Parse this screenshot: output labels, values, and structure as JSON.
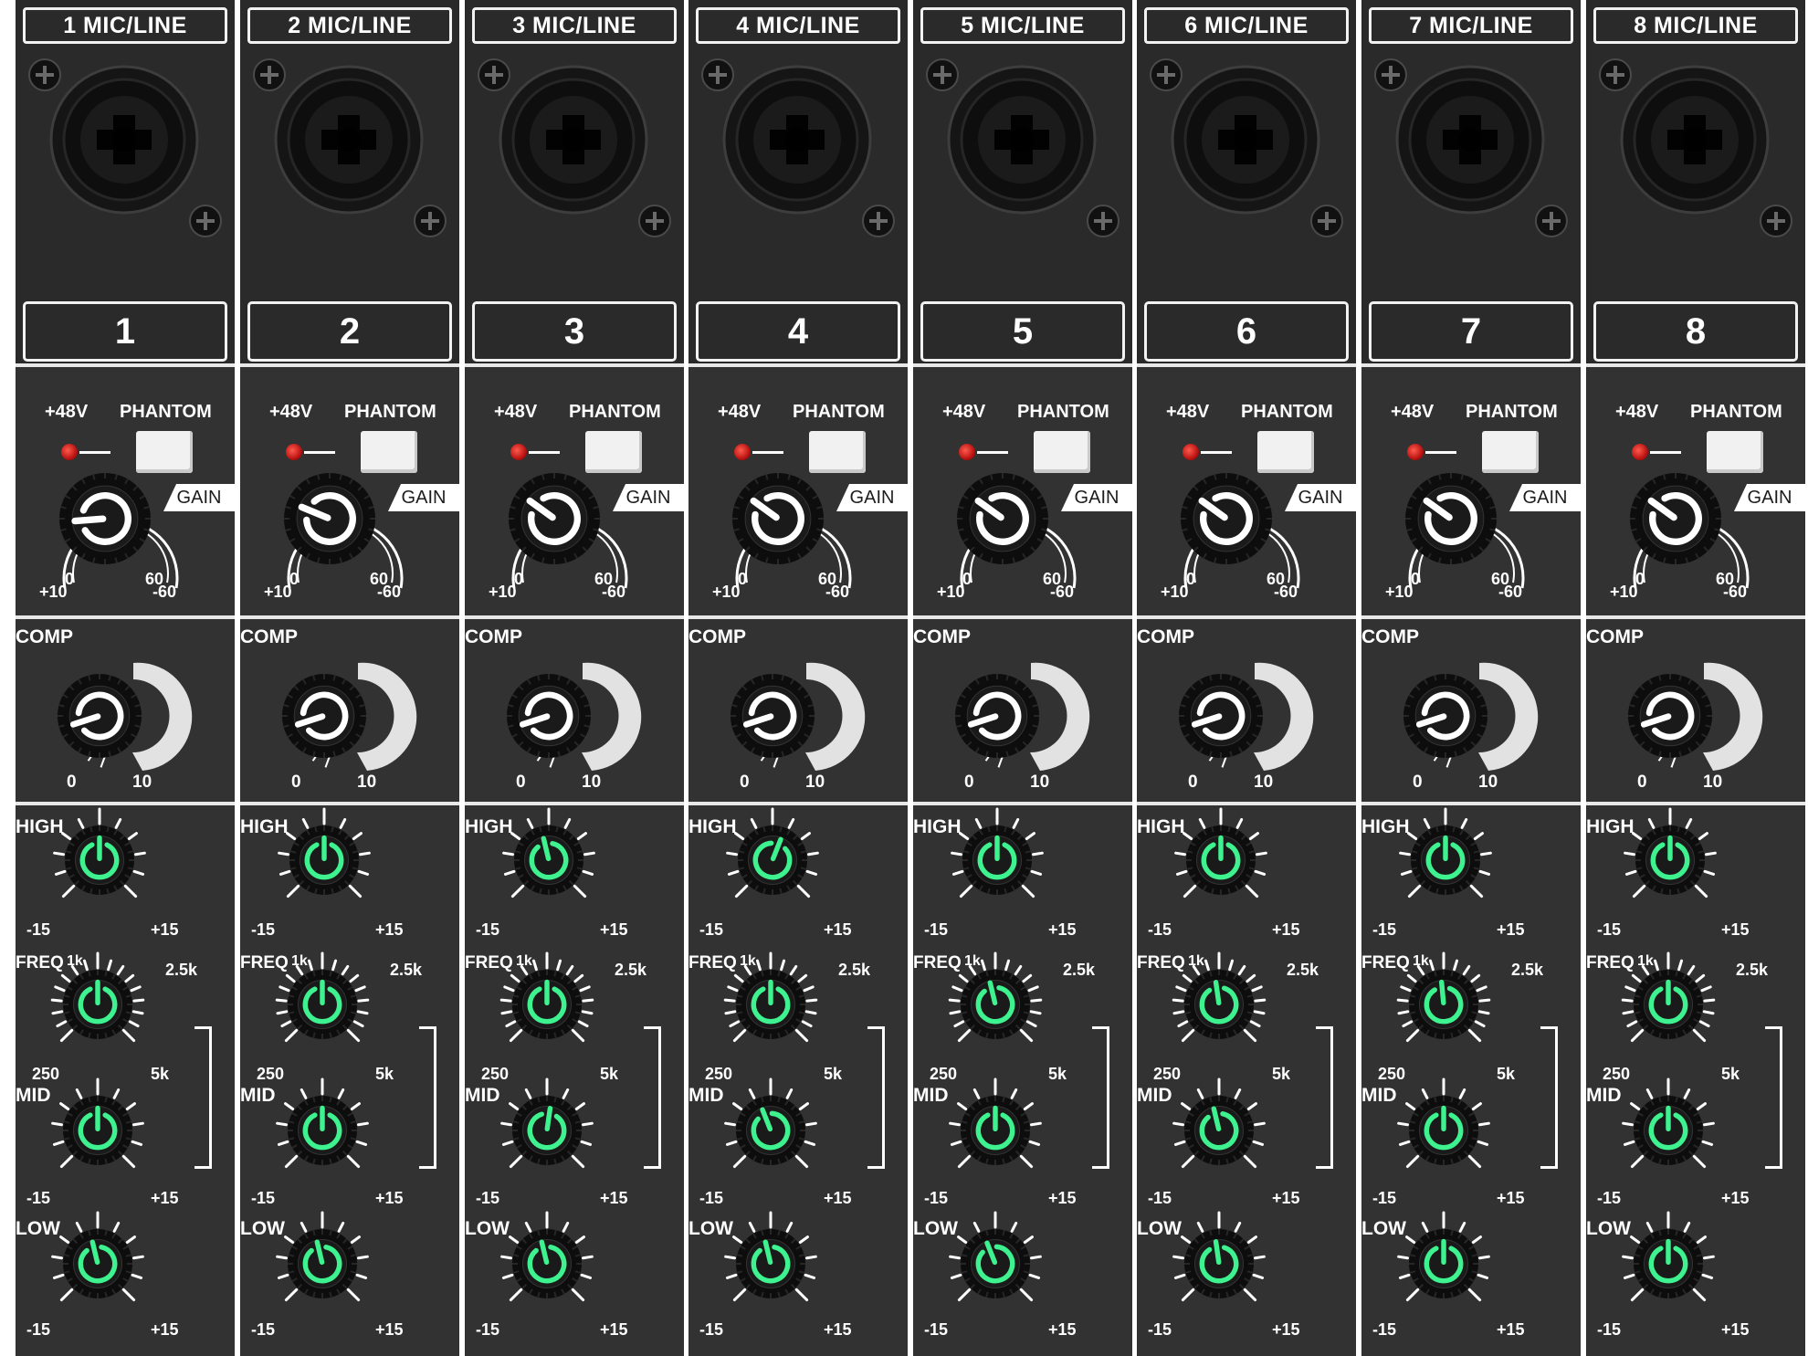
{
  "colors": {
    "panel": "#323232",
    "panel_dark": "#2a2a2a",
    "divider": "#e8e8e8",
    "label": "#ffffff",
    "eq_indicator": "#3df28f",
    "phantom_led": "#d41515",
    "phantom_button": "#f1f1f1"
  },
  "icons": {
    "input_jack": "xlr-combo-jack-icon",
    "panel_screw": "screw-icon",
    "phantom_led": "led-icon"
  },
  "labels": {
    "phantom_voltage": "+48V",
    "phantom": "PHANTOM",
    "gain": "GAIN",
    "gain_scale": [
      "+10",
      "0",
      "60",
      "-60"
    ],
    "comp": "COMP",
    "comp_scale": [
      "0",
      "10"
    ],
    "high": "HIGH",
    "freq": "FREQ",
    "freq_scale": [
      "1k",
      "2.5k",
      "250",
      "5k"
    ],
    "mid": "MID",
    "low": "LOW",
    "eq_scale": [
      "-15",
      "+15"
    ]
  },
  "channels": [
    {
      "title": "1 MIC/LINE",
      "number": "1",
      "phantom_on": true,
      "gain": 0.15,
      "comp": 0.1,
      "high": 0.5,
      "freq": 0.5,
      "mid": 0.5,
      "low": 0.45
    },
    {
      "title": "2 MIC/LINE",
      "number": "2",
      "phantom_on": true,
      "gain": 0.25,
      "comp": 0.1,
      "high": 0.5,
      "freq": 0.5,
      "mid": 0.5,
      "low": 0.45
    },
    {
      "title": "3 MIC/LINE",
      "number": "3",
      "phantom_on": true,
      "gain": 0.3,
      "comp": 0.1,
      "high": 0.45,
      "freq": 0.5,
      "mid": 0.53,
      "low": 0.45
    },
    {
      "title": "4 MIC/LINE",
      "number": "4",
      "phantom_on": true,
      "gain": 0.3,
      "comp": 0.1,
      "high": 0.58,
      "freq": 0.5,
      "mid": 0.42,
      "low": 0.45
    },
    {
      "title": "5 MIC/LINE",
      "number": "5",
      "phantom_on": true,
      "gain": 0.3,
      "comp": 0.1,
      "high": 0.5,
      "freq": 0.45,
      "mid": 0.5,
      "low": 0.42
    },
    {
      "title": "6 MIC/LINE",
      "number": "6",
      "phantom_on": true,
      "gain": 0.3,
      "comp": 0.1,
      "high": 0.5,
      "freq": 0.47,
      "mid": 0.45,
      "low": 0.47
    },
    {
      "title": "7 MIC/LINE",
      "number": "7",
      "phantom_on": true,
      "gain": 0.3,
      "comp": 0.1,
      "high": 0.5,
      "freq": 0.48,
      "mid": 0.5,
      "low": 0.5
    },
    {
      "title": "8 MIC/LINE",
      "number": "8",
      "phantom_on": true,
      "gain": 0.3,
      "comp": 0.1,
      "high": 0.5,
      "freq": 0.5,
      "mid": 0.5,
      "low": 0.5
    }
  ]
}
